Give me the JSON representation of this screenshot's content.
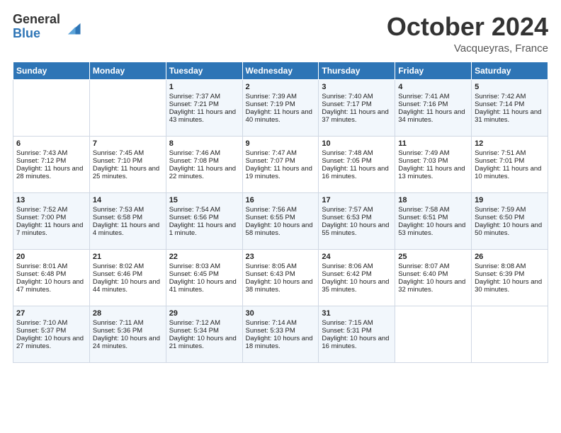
{
  "header": {
    "logo_line1": "General",
    "logo_line2": "Blue",
    "month": "October 2024",
    "location": "Vacqueyras, France"
  },
  "days_of_week": [
    "Sunday",
    "Monday",
    "Tuesday",
    "Wednesday",
    "Thursday",
    "Friday",
    "Saturday"
  ],
  "weeks": [
    [
      null,
      null,
      {
        "day": 1,
        "sunrise": "Sunrise: 7:37 AM",
        "sunset": "Sunset: 7:21 PM",
        "daylight": "Daylight: 11 hours and 43 minutes."
      },
      {
        "day": 2,
        "sunrise": "Sunrise: 7:39 AM",
        "sunset": "Sunset: 7:19 PM",
        "daylight": "Daylight: 11 hours and 40 minutes."
      },
      {
        "day": 3,
        "sunrise": "Sunrise: 7:40 AM",
        "sunset": "Sunset: 7:17 PM",
        "daylight": "Daylight: 11 hours and 37 minutes."
      },
      {
        "day": 4,
        "sunrise": "Sunrise: 7:41 AM",
        "sunset": "Sunset: 7:16 PM",
        "daylight": "Daylight: 11 hours and 34 minutes."
      },
      {
        "day": 5,
        "sunrise": "Sunrise: 7:42 AM",
        "sunset": "Sunset: 7:14 PM",
        "daylight": "Daylight: 11 hours and 31 minutes."
      }
    ],
    [
      {
        "day": 6,
        "sunrise": "Sunrise: 7:43 AM",
        "sunset": "Sunset: 7:12 PM",
        "daylight": "Daylight: 11 hours and 28 minutes."
      },
      {
        "day": 7,
        "sunrise": "Sunrise: 7:45 AM",
        "sunset": "Sunset: 7:10 PM",
        "daylight": "Daylight: 11 hours and 25 minutes."
      },
      {
        "day": 8,
        "sunrise": "Sunrise: 7:46 AM",
        "sunset": "Sunset: 7:08 PM",
        "daylight": "Daylight: 11 hours and 22 minutes."
      },
      {
        "day": 9,
        "sunrise": "Sunrise: 7:47 AM",
        "sunset": "Sunset: 7:07 PM",
        "daylight": "Daylight: 11 hours and 19 minutes."
      },
      {
        "day": 10,
        "sunrise": "Sunrise: 7:48 AM",
        "sunset": "Sunset: 7:05 PM",
        "daylight": "Daylight: 11 hours and 16 minutes."
      },
      {
        "day": 11,
        "sunrise": "Sunrise: 7:49 AM",
        "sunset": "Sunset: 7:03 PM",
        "daylight": "Daylight: 11 hours and 13 minutes."
      },
      {
        "day": 12,
        "sunrise": "Sunrise: 7:51 AM",
        "sunset": "Sunset: 7:01 PM",
        "daylight": "Daylight: 11 hours and 10 minutes."
      }
    ],
    [
      {
        "day": 13,
        "sunrise": "Sunrise: 7:52 AM",
        "sunset": "Sunset: 7:00 PM",
        "daylight": "Daylight: 11 hours and 7 minutes."
      },
      {
        "day": 14,
        "sunrise": "Sunrise: 7:53 AM",
        "sunset": "Sunset: 6:58 PM",
        "daylight": "Daylight: 11 hours and 4 minutes."
      },
      {
        "day": 15,
        "sunrise": "Sunrise: 7:54 AM",
        "sunset": "Sunset: 6:56 PM",
        "daylight": "Daylight: 11 hours and 1 minute."
      },
      {
        "day": 16,
        "sunrise": "Sunrise: 7:56 AM",
        "sunset": "Sunset: 6:55 PM",
        "daylight": "Daylight: 10 hours and 58 minutes."
      },
      {
        "day": 17,
        "sunrise": "Sunrise: 7:57 AM",
        "sunset": "Sunset: 6:53 PM",
        "daylight": "Daylight: 10 hours and 55 minutes."
      },
      {
        "day": 18,
        "sunrise": "Sunrise: 7:58 AM",
        "sunset": "Sunset: 6:51 PM",
        "daylight": "Daylight: 10 hours and 53 minutes."
      },
      {
        "day": 19,
        "sunrise": "Sunrise: 7:59 AM",
        "sunset": "Sunset: 6:50 PM",
        "daylight": "Daylight: 10 hours and 50 minutes."
      }
    ],
    [
      {
        "day": 20,
        "sunrise": "Sunrise: 8:01 AM",
        "sunset": "Sunset: 6:48 PM",
        "daylight": "Daylight: 10 hours and 47 minutes."
      },
      {
        "day": 21,
        "sunrise": "Sunrise: 8:02 AM",
        "sunset": "Sunset: 6:46 PM",
        "daylight": "Daylight: 10 hours and 44 minutes."
      },
      {
        "day": 22,
        "sunrise": "Sunrise: 8:03 AM",
        "sunset": "Sunset: 6:45 PM",
        "daylight": "Daylight: 10 hours and 41 minutes."
      },
      {
        "day": 23,
        "sunrise": "Sunrise: 8:05 AM",
        "sunset": "Sunset: 6:43 PM",
        "daylight": "Daylight: 10 hours and 38 minutes."
      },
      {
        "day": 24,
        "sunrise": "Sunrise: 8:06 AM",
        "sunset": "Sunset: 6:42 PM",
        "daylight": "Daylight: 10 hours and 35 minutes."
      },
      {
        "day": 25,
        "sunrise": "Sunrise: 8:07 AM",
        "sunset": "Sunset: 6:40 PM",
        "daylight": "Daylight: 10 hours and 32 minutes."
      },
      {
        "day": 26,
        "sunrise": "Sunrise: 8:08 AM",
        "sunset": "Sunset: 6:39 PM",
        "daylight": "Daylight: 10 hours and 30 minutes."
      }
    ],
    [
      {
        "day": 27,
        "sunrise": "Sunrise: 7:10 AM",
        "sunset": "Sunset: 5:37 PM",
        "daylight": "Daylight: 10 hours and 27 minutes."
      },
      {
        "day": 28,
        "sunrise": "Sunrise: 7:11 AM",
        "sunset": "Sunset: 5:36 PM",
        "daylight": "Daylight: 10 hours and 24 minutes."
      },
      {
        "day": 29,
        "sunrise": "Sunrise: 7:12 AM",
        "sunset": "Sunset: 5:34 PM",
        "daylight": "Daylight: 10 hours and 21 minutes."
      },
      {
        "day": 30,
        "sunrise": "Sunrise: 7:14 AM",
        "sunset": "Sunset: 5:33 PM",
        "daylight": "Daylight: 10 hours and 18 minutes."
      },
      {
        "day": 31,
        "sunrise": "Sunrise: 7:15 AM",
        "sunset": "Sunset: 5:31 PM",
        "daylight": "Daylight: 10 hours and 16 minutes."
      },
      null,
      null
    ]
  ]
}
